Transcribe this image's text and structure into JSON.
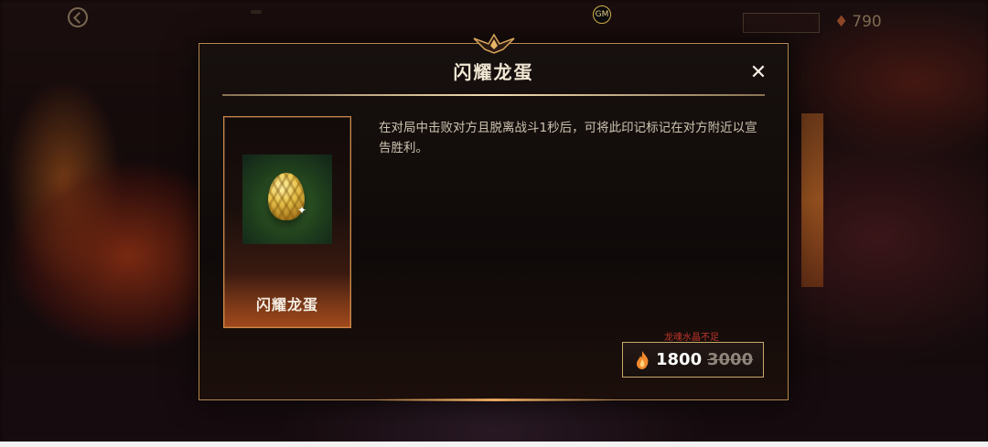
{
  "topbar": {
    "tabs": [
      "",
      "",
      "",
      "",
      ""
    ],
    "gm_label": "GM",
    "right_button": "",
    "currency_amount": "790"
  },
  "modal": {
    "title": "闪耀龙蛋",
    "close_symbol": "✕",
    "item": {
      "name": "闪耀龙蛋",
      "image": "golden-dragon-egg"
    },
    "description": "在对局中击败对方且脱离战斗1秒后，可将此印记标记在对方附近以宣告胜利。",
    "price": {
      "warning": "龙魂水晶不足",
      "current": "1800",
      "original": "3000",
      "currency_icon": "flame-crystal-icon"
    }
  },
  "colors": {
    "accent_gold": "#c9a86a",
    "warning_red": "#c0342c"
  }
}
